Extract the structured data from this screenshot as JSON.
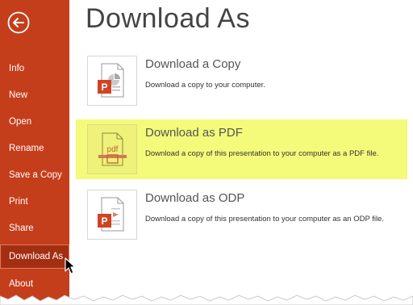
{
  "sidebar": {
    "items": [
      {
        "label": "Info"
      },
      {
        "label": "New"
      },
      {
        "label": "Open"
      },
      {
        "label": "Rename"
      },
      {
        "label": "Save a Copy"
      },
      {
        "label": "Print"
      },
      {
        "label": "Share"
      },
      {
        "label": "Download As",
        "selected": true
      },
      {
        "label": "About"
      }
    ],
    "back_icon": "back-arrow-icon",
    "accent_color": "#c43e1c"
  },
  "main": {
    "title": "Download As",
    "options": [
      {
        "title": "Download a Copy",
        "description": "Download a copy to your computer.",
        "icon": "pptx-file-icon"
      },
      {
        "title": "Download as PDF",
        "description": "Download a copy of this presentation to your computer as a PDF file.",
        "icon": "pdf-file-icon",
        "highlighted": true,
        "icon_label": "pdf"
      },
      {
        "title": "Download as ODP",
        "description": "Download a copy of this presentation to your computer as an ODP file.",
        "icon": "odp-file-icon"
      }
    ],
    "highlight_color": "#f4fa7a"
  }
}
